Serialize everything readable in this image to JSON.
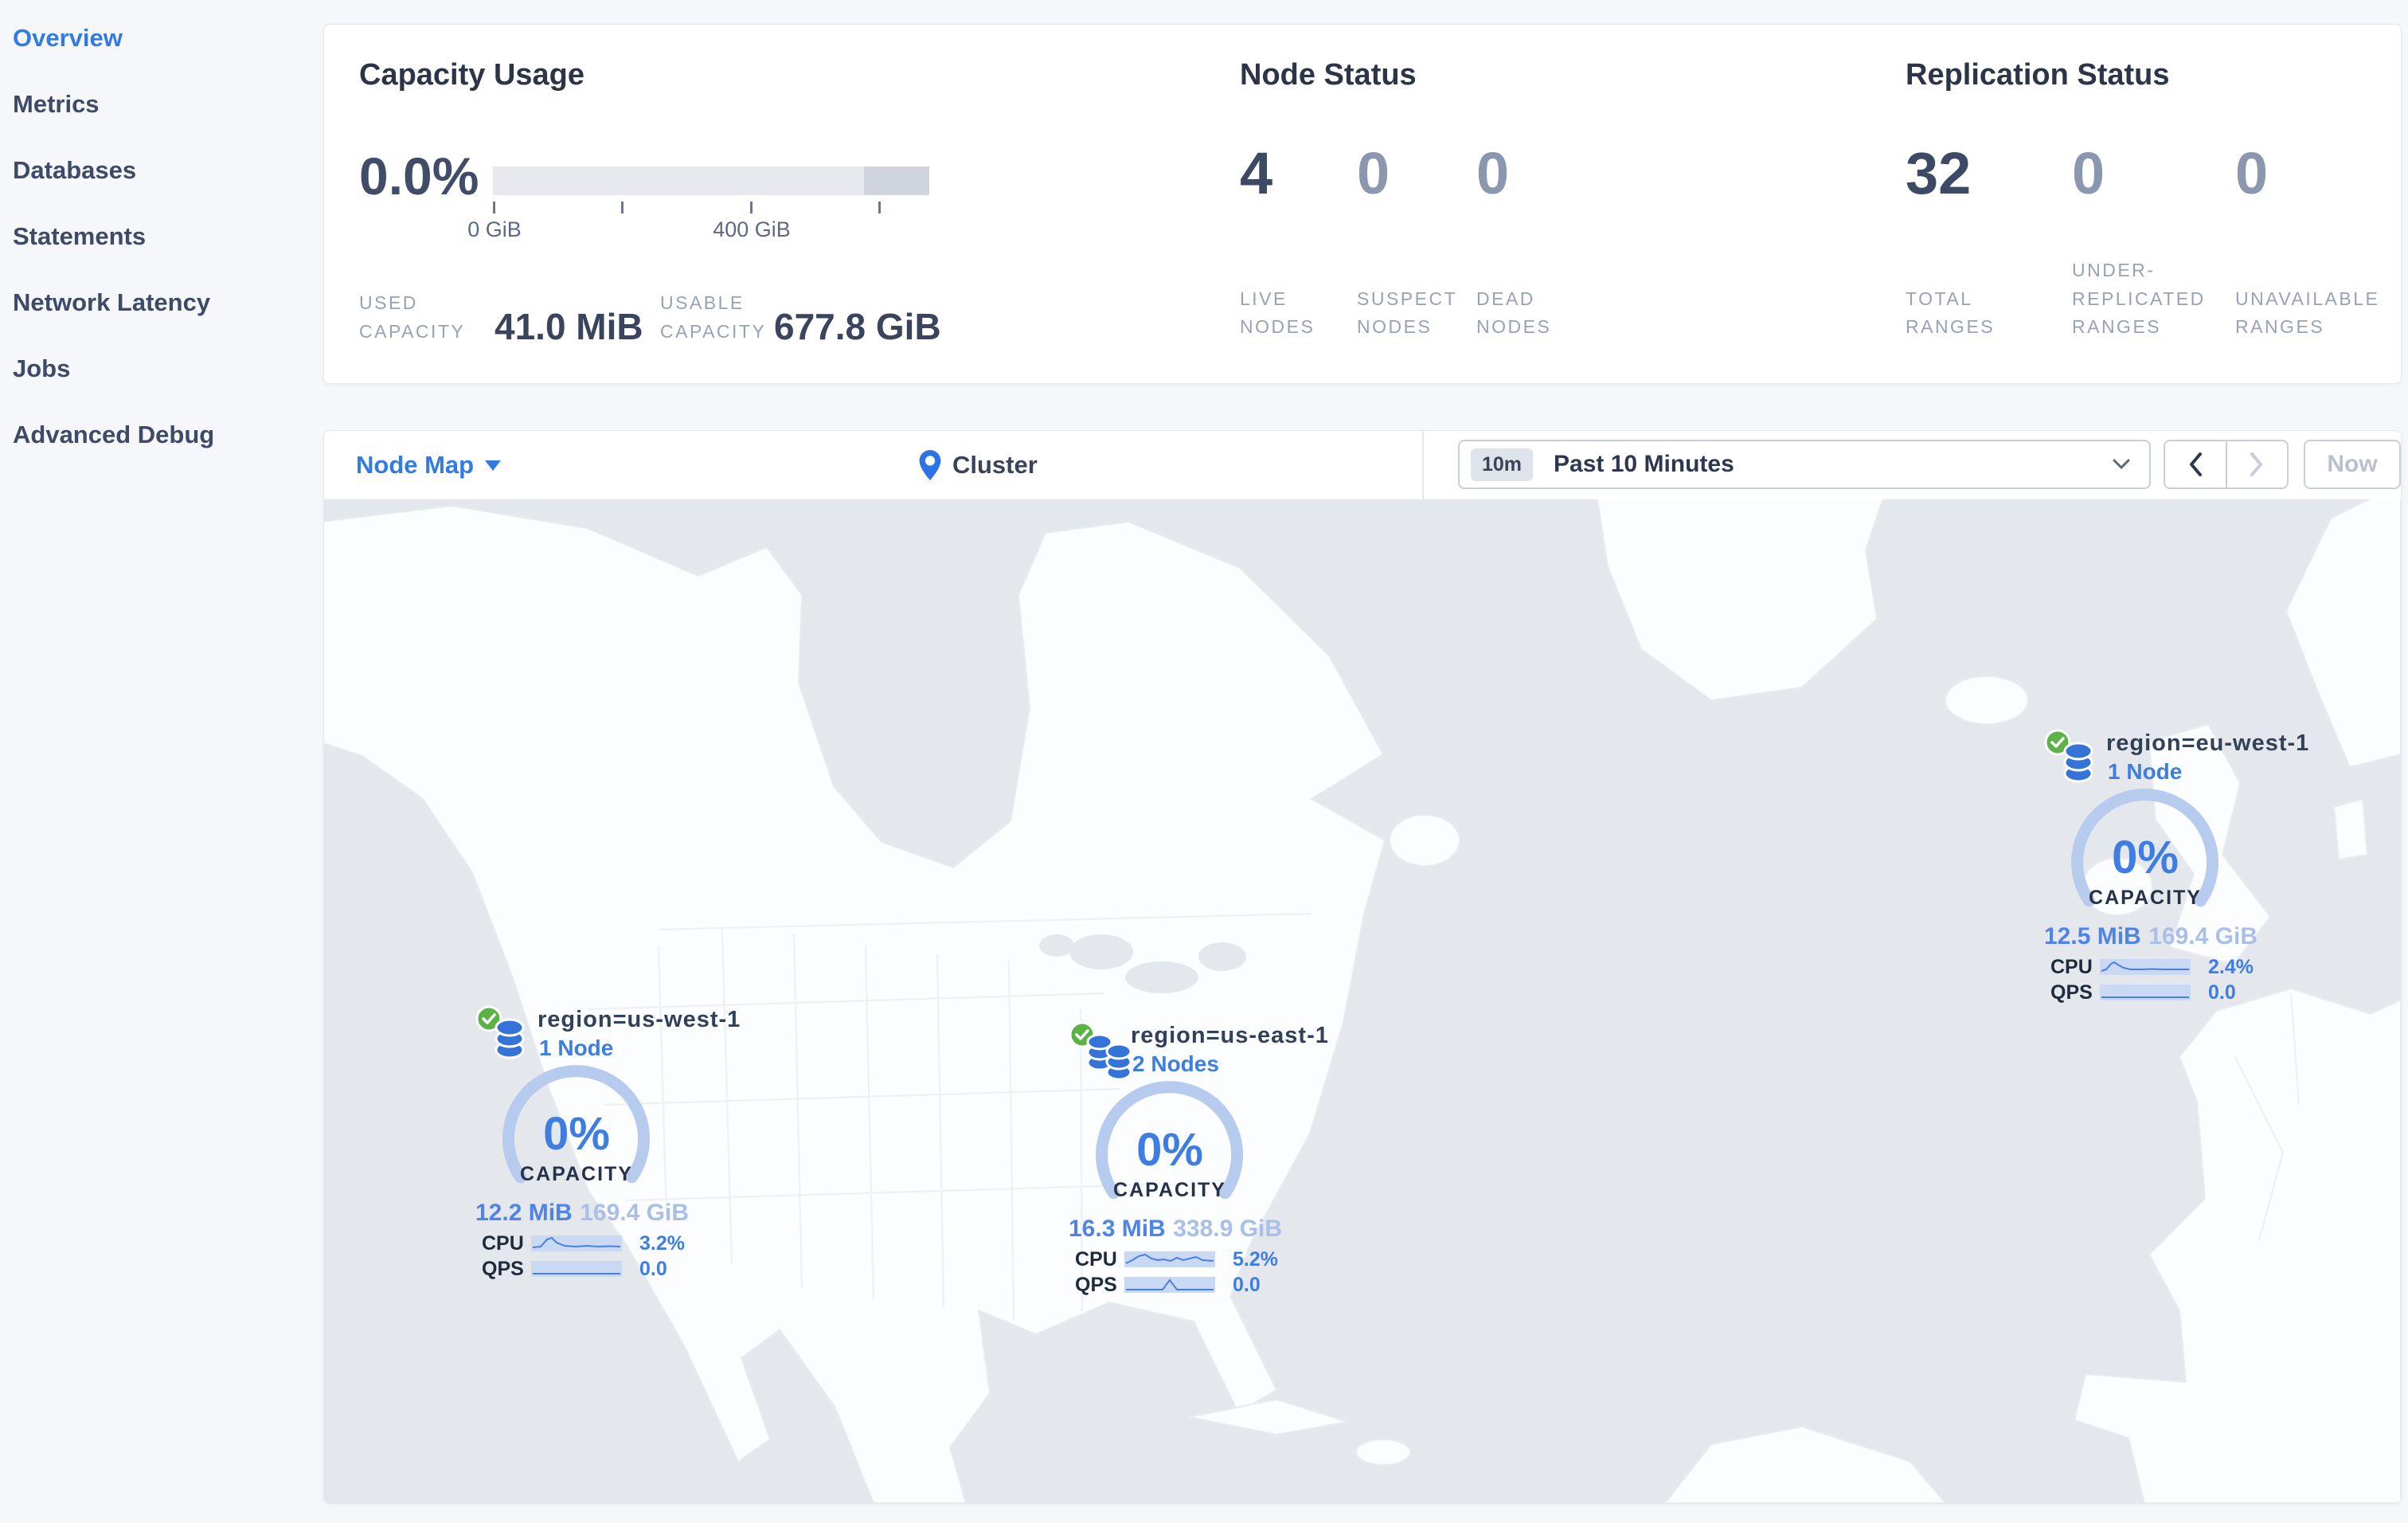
{
  "sidebar": {
    "items": [
      {
        "label": "Overview",
        "active": true
      },
      {
        "label": "Metrics",
        "active": false
      },
      {
        "label": "Databases",
        "active": false
      },
      {
        "label": "Statements",
        "active": false
      },
      {
        "label": "Network Latency",
        "active": false
      },
      {
        "label": "Jobs",
        "active": false
      },
      {
        "label": "Advanced Debug",
        "active": false
      }
    ]
  },
  "capacity_usage": {
    "title": "Capacity Usage",
    "percent": "0.0%",
    "tick_label_zero": "0 GiB",
    "tick_label_mid": "400 GiB",
    "used_label": "USED CAPACITY",
    "used_value": "41.0 MiB",
    "usable_label": "USABLE CAPACITY",
    "usable_value": "677.8 GiB"
  },
  "node_status": {
    "title": "Node Status",
    "metrics": [
      {
        "value": "4",
        "label": "LIVE NODES"
      },
      {
        "value": "0",
        "label": "SUSPECT NODES"
      },
      {
        "value": "0",
        "label": "DEAD NODES"
      }
    ]
  },
  "replication_status": {
    "title": "Replication Status",
    "metrics": [
      {
        "value": "32",
        "label": "TOTAL RANGES"
      },
      {
        "value": "0",
        "label": "UNDER-REPLICATED RANGES"
      },
      {
        "value": "0",
        "label": "UNAVAILABLE RANGES"
      }
    ]
  },
  "toolbar": {
    "view_label": "Node Map",
    "breadcrumb": "Cluster",
    "time_badge": "10m",
    "time_range": "Past 10 Minutes",
    "now_label": "Now"
  },
  "map": {
    "regions": [
      {
        "name": "region=us-west-1",
        "nodes": "1 Node",
        "capacity_percent": "0%",
        "capacity_label": "CAPACITY",
        "used": "12.2 MiB",
        "usable": "169.4 GiB",
        "cpu_label": "CPU",
        "cpu_value": "3.2%",
        "qps_label": "QPS",
        "qps_value": "0.0"
      },
      {
        "name": "region=us-east-1",
        "nodes": "2 Nodes",
        "capacity_percent": "0%",
        "capacity_label": "CAPACITY",
        "used": "16.3 MiB",
        "usable": "338.9 GiB",
        "cpu_label": "CPU",
        "cpu_value": "5.2%",
        "qps_label": "QPS",
        "qps_value": "0.0"
      },
      {
        "name": "region=eu-west-1",
        "nodes": "1 Node",
        "capacity_percent": "0%",
        "capacity_label": "CAPACITY",
        "used": "12.5 MiB",
        "usable": "169.4 GiB",
        "cpu_label": "CPU",
        "cpu_value": "2.4%",
        "qps_label": "QPS",
        "qps_value": "0.0"
      }
    ]
  },
  "colors": {
    "active_nav": "#337ae3",
    "accent_blue": "#3e7de2",
    "gauge_arc": "#b7cbee",
    "healthy_green": "#5cb247",
    "ocean": "#e4e7ec",
    "land": "#fcfdfe"
  }
}
